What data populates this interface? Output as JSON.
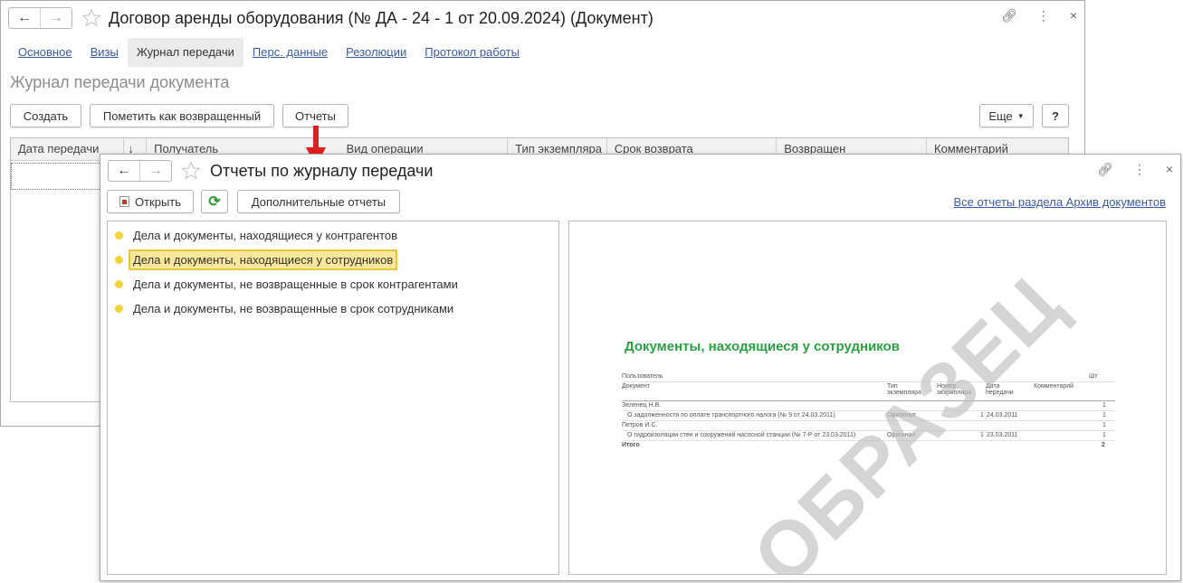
{
  "back_window": {
    "title": "Договор аренды оборудования (№ ДА - 24 - 1 от 20.09.2024) (Документ)",
    "tabs": [
      "Основное",
      "Визы",
      "Журнал передачи",
      "Перс. данные",
      "Резолюции",
      "Протокол работы"
    ],
    "active_tab": "Журнал передачи",
    "section_title": "Журнал передачи документа",
    "buttons": {
      "create": "Создать",
      "mark_returned": "Пометить как возвращенный",
      "reports": "Отчеты",
      "more": "Еще",
      "help": "?"
    },
    "columns": [
      "Дата передачи",
      "↓",
      "Получатель",
      "Вид операции",
      "Тип экземпляра",
      "Срок возврата",
      "Возвращен",
      "Комментарий"
    ]
  },
  "front_window": {
    "title": "Отчеты по журналу передачи",
    "buttons": {
      "open": "Открыть",
      "additional": "Дополнительные отчеты"
    },
    "all_reports_link": "Все отчеты раздела Архив документов",
    "reports": [
      "Дела и документы, находящиеся у контрагентов",
      "Дела и документы, находящиеся у сотрудников",
      "Дела и документы, не возвращенные в срок контрагентами",
      "Дела и документы, не возвращенные в срок сотрудниками"
    ],
    "selected_report_index": 1,
    "preview": {
      "title": "Документы, находящиеся у сотрудников",
      "header": {
        "user": "Пользователь",
        "document": "Документ",
        "type": "Тип экземпляра",
        "number": "Номер экземпляра",
        "date": "Дата передачи",
        "comment": "Комментарий",
        "qty": "Шт"
      },
      "rows": [
        {
          "name": "Зеленец Н.В.",
          "qty": "1"
        },
        {
          "name": "О задолженности по оплате транспортного налога (№ 9 от 24.03.2011)",
          "type": "Оригинал",
          "number": "1",
          "date": "24.03.2011",
          "qty": "1"
        },
        {
          "name": "Петров И.С.",
          "qty": "1"
        },
        {
          "name": "О гидроизоляции стен и сооружений насосной станции (№ 7-Р от 23.03.2011)",
          "type": "Оригинал",
          "number": "1",
          "date": "23.03.2011",
          "qty": "1"
        }
      ],
      "total_label": "Итого",
      "total_qty": "2",
      "watermark": "ОБРАЗЕЦ"
    }
  },
  "colors": {
    "link": "#3a5ba0",
    "highlight": "#fbe89a",
    "report_title": "#2aa043",
    "arrow": "#e02020"
  }
}
